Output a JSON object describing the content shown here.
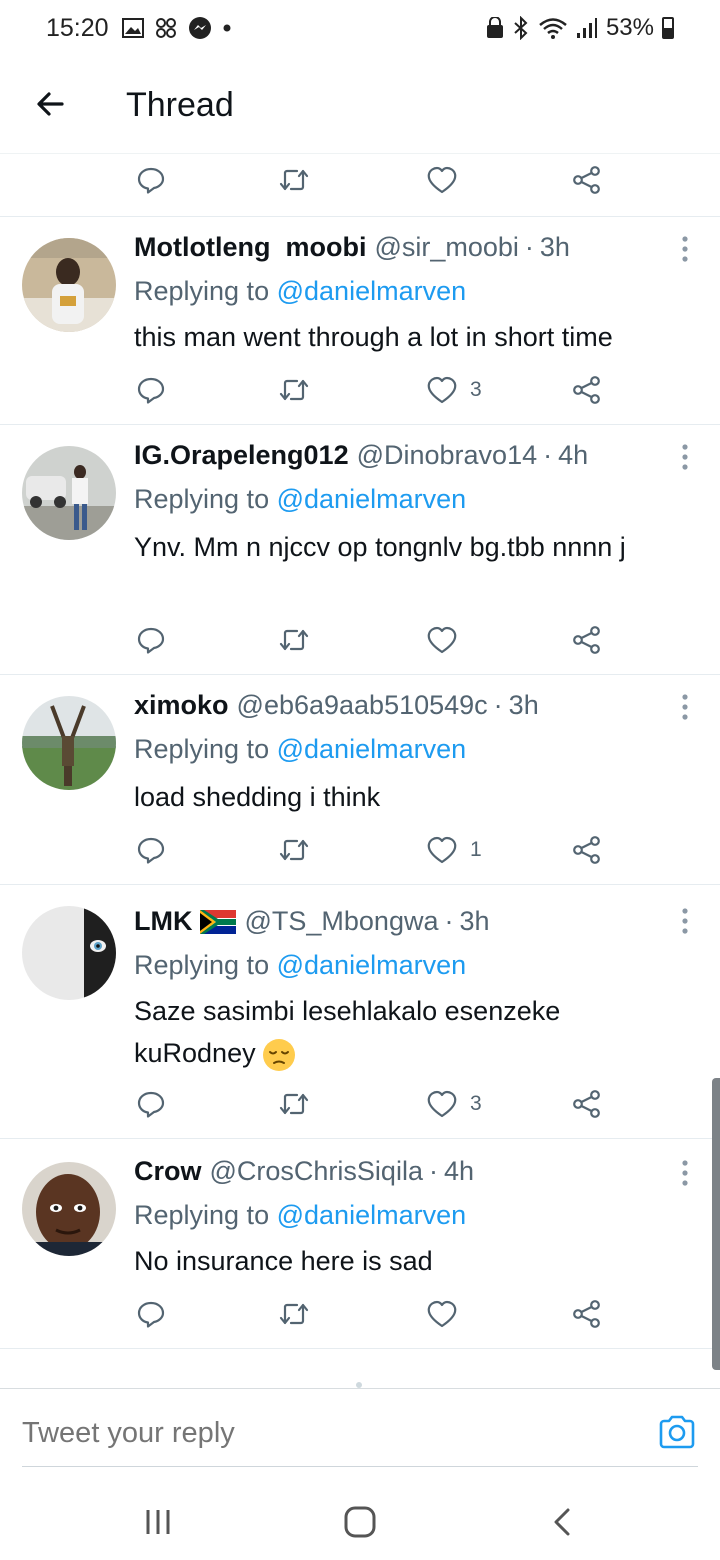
{
  "status_bar": {
    "time": "15:20",
    "left_icons": [
      "image-icon",
      "pinwheel-icon",
      "messenger-icon",
      "dot-icon"
    ],
    "right_icons": [
      "secure-icon",
      "bluetooth-icon",
      "wifi-icon",
      "signal-icon"
    ],
    "battery": "53%"
  },
  "header": {
    "title": "Thread",
    "back_icon": "arrow-left-icon"
  },
  "tweets": [
    {
      "name": "Motlotleng  moobi",
      "handle": "@sir_moobi",
      "time": "3h",
      "reply_prefix": "Replying to",
      "reply_to": "@danielmarven",
      "text": "this man went through a lot in short time",
      "likes": "3"
    },
    {
      "name": "IG.Orapeleng012",
      "handle": "@Dinobravo14",
      "time": "4h",
      "reply_prefix": "Replying to",
      "reply_to": "@danielmarven",
      "text": "Ynv.  Mm n njccv  op tongnlv bg.tbb nnnn j",
      "likes": ""
    },
    {
      "name": "ximoko",
      "handle": "@eb6a9aab510549c",
      "time": "3h",
      "reply_prefix": "Replying to",
      "reply_to": "@danielmarven",
      "text": "load shedding i think",
      "likes": "1"
    },
    {
      "name": "LMK",
      "name_emoji": "south-africa-flag",
      "handle": "@TS_Mbongwa",
      "time": "3h",
      "reply_prefix": "Replying to",
      "reply_to": "@danielmarven",
      "text": "Saze sasimbi lesehlakalo esenzeke kuRodney",
      "text_emoji": "pensive-face",
      "likes": "3"
    },
    {
      "name": "Crow",
      "handle": "@CrosChrisSiqila",
      "time": "4h",
      "reply_prefix": "Replying to",
      "reply_to": "@danielmarven",
      "text": "No insurance here is sad",
      "likes": ""
    }
  ],
  "reply_bar": {
    "placeholder": "Tweet your reply",
    "camera_icon": "camera-icon"
  },
  "nav_bar": {
    "buttons": [
      "recents-icon",
      "home-icon",
      "back-icon"
    ]
  },
  "colors": {
    "accent": "#1d9bf0",
    "secondary_text": "#536471",
    "divider": "#e6ecf0"
  }
}
